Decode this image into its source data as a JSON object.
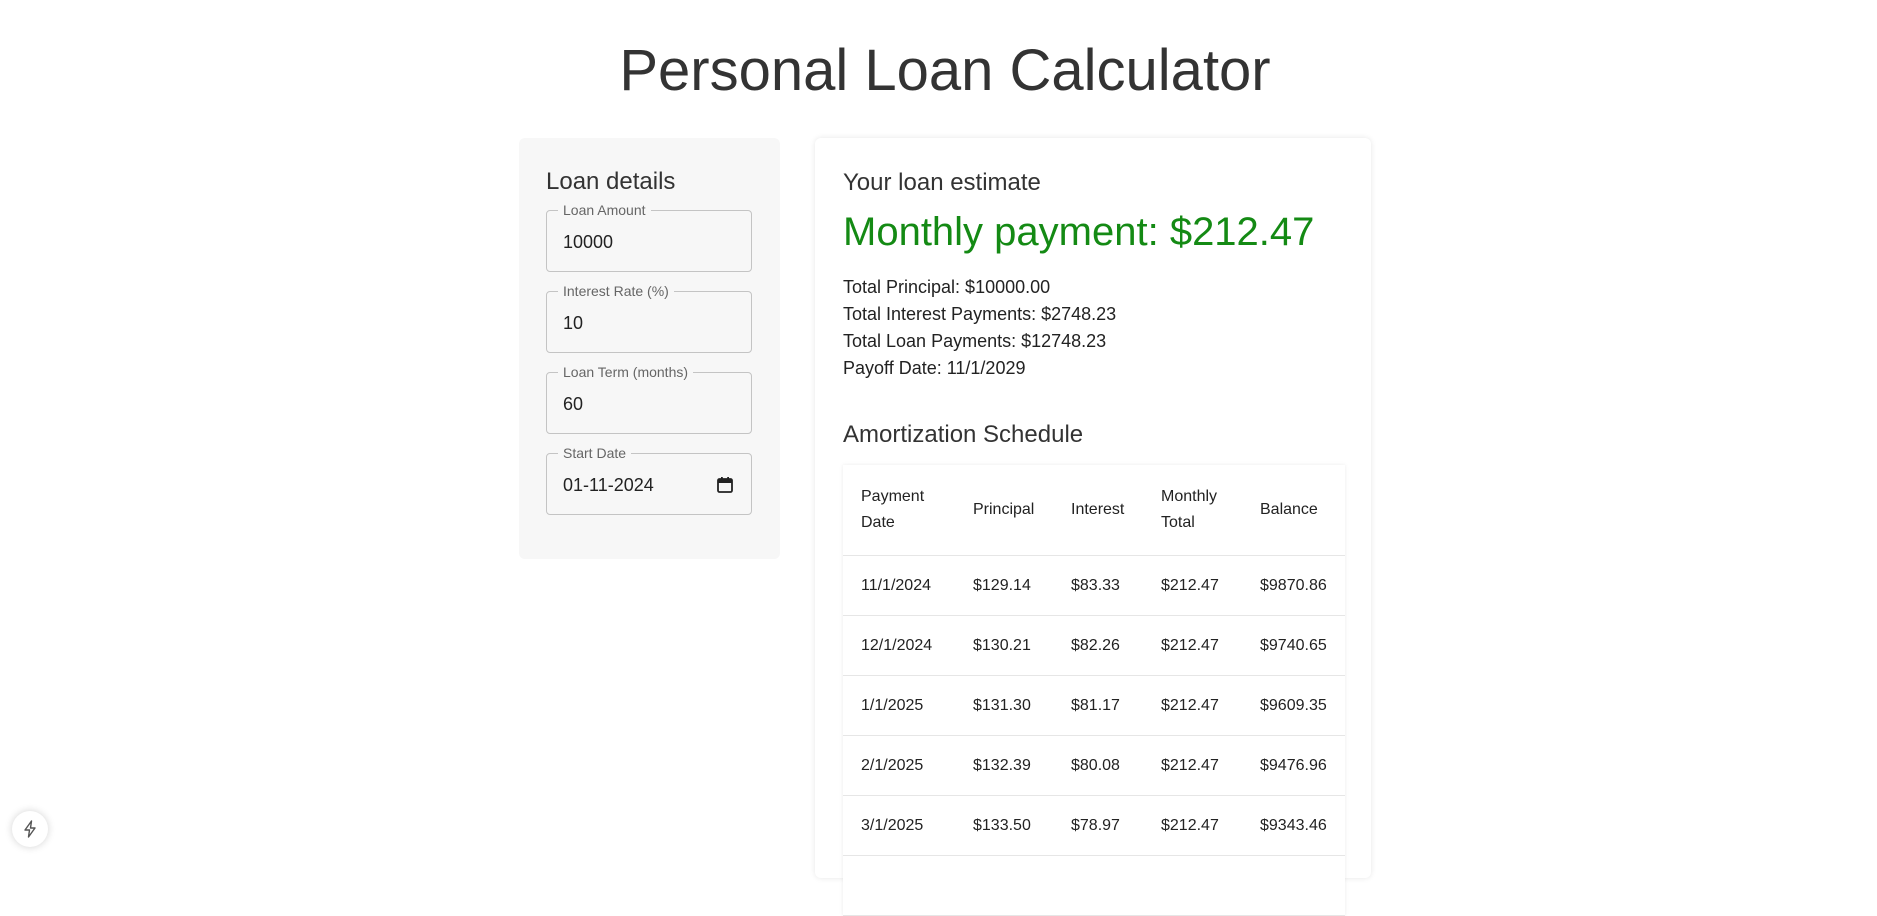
{
  "title": "Personal Loan Calculator",
  "loan_details": {
    "heading": "Loan details",
    "fields": [
      {
        "label": "Loan Amount",
        "value": "10000"
      },
      {
        "label": "Interest Rate (%)",
        "value": "10"
      },
      {
        "label": "Loan Term (months)",
        "value": "60"
      },
      {
        "label": "Start Date",
        "value": "01-11-2024"
      }
    ]
  },
  "estimate": {
    "heading": "Your loan estimate",
    "monthly_payment": "Monthly payment: $212.47",
    "total_principal": "Total Principal: $10000.00",
    "total_interest": "Total Interest Payments: $2748.23",
    "total_payments": "Total Loan Payments: $12748.23",
    "payoff_date": "Payoff Date: 11/1/2029"
  },
  "amortization": {
    "heading": "Amortization Schedule",
    "columns": [
      "Payment Date",
      "Principal",
      "Interest",
      "Monthly Total",
      "Balance"
    ],
    "rows": [
      [
        "11/1/2024",
        "$129.14",
        "$83.33",
        "$212.47",
        "$9870.86"
      ],
      [
        "12/1/2024",
        "$130.21",
        "$82.26",
        "$212.47",
        "$9740.65"
      ],
      [
        "1/1/2025",
        "$131.30",
        "$81.17",
        "$212.47",
        "$9609.35"
      ],
      [
        "2/1/2025",
        "$132.39",
        "$80.08",
        "$212.47",
        "$9476.96"
      ],
      [
        "3/1/2025",
        "$133.50",
        "$78.97",
        "$212.47",
        "$9343.46"
      ]
    ]
  },
  "colors": {
    "monthly_payment": "#148a14",
    "panel_background": "#f7f7f7",
    "text": "#333333"
  },
  "icons": {
    "calendar": "calendar-icon",
    "devtools": "bolt-icon"
  }
}
